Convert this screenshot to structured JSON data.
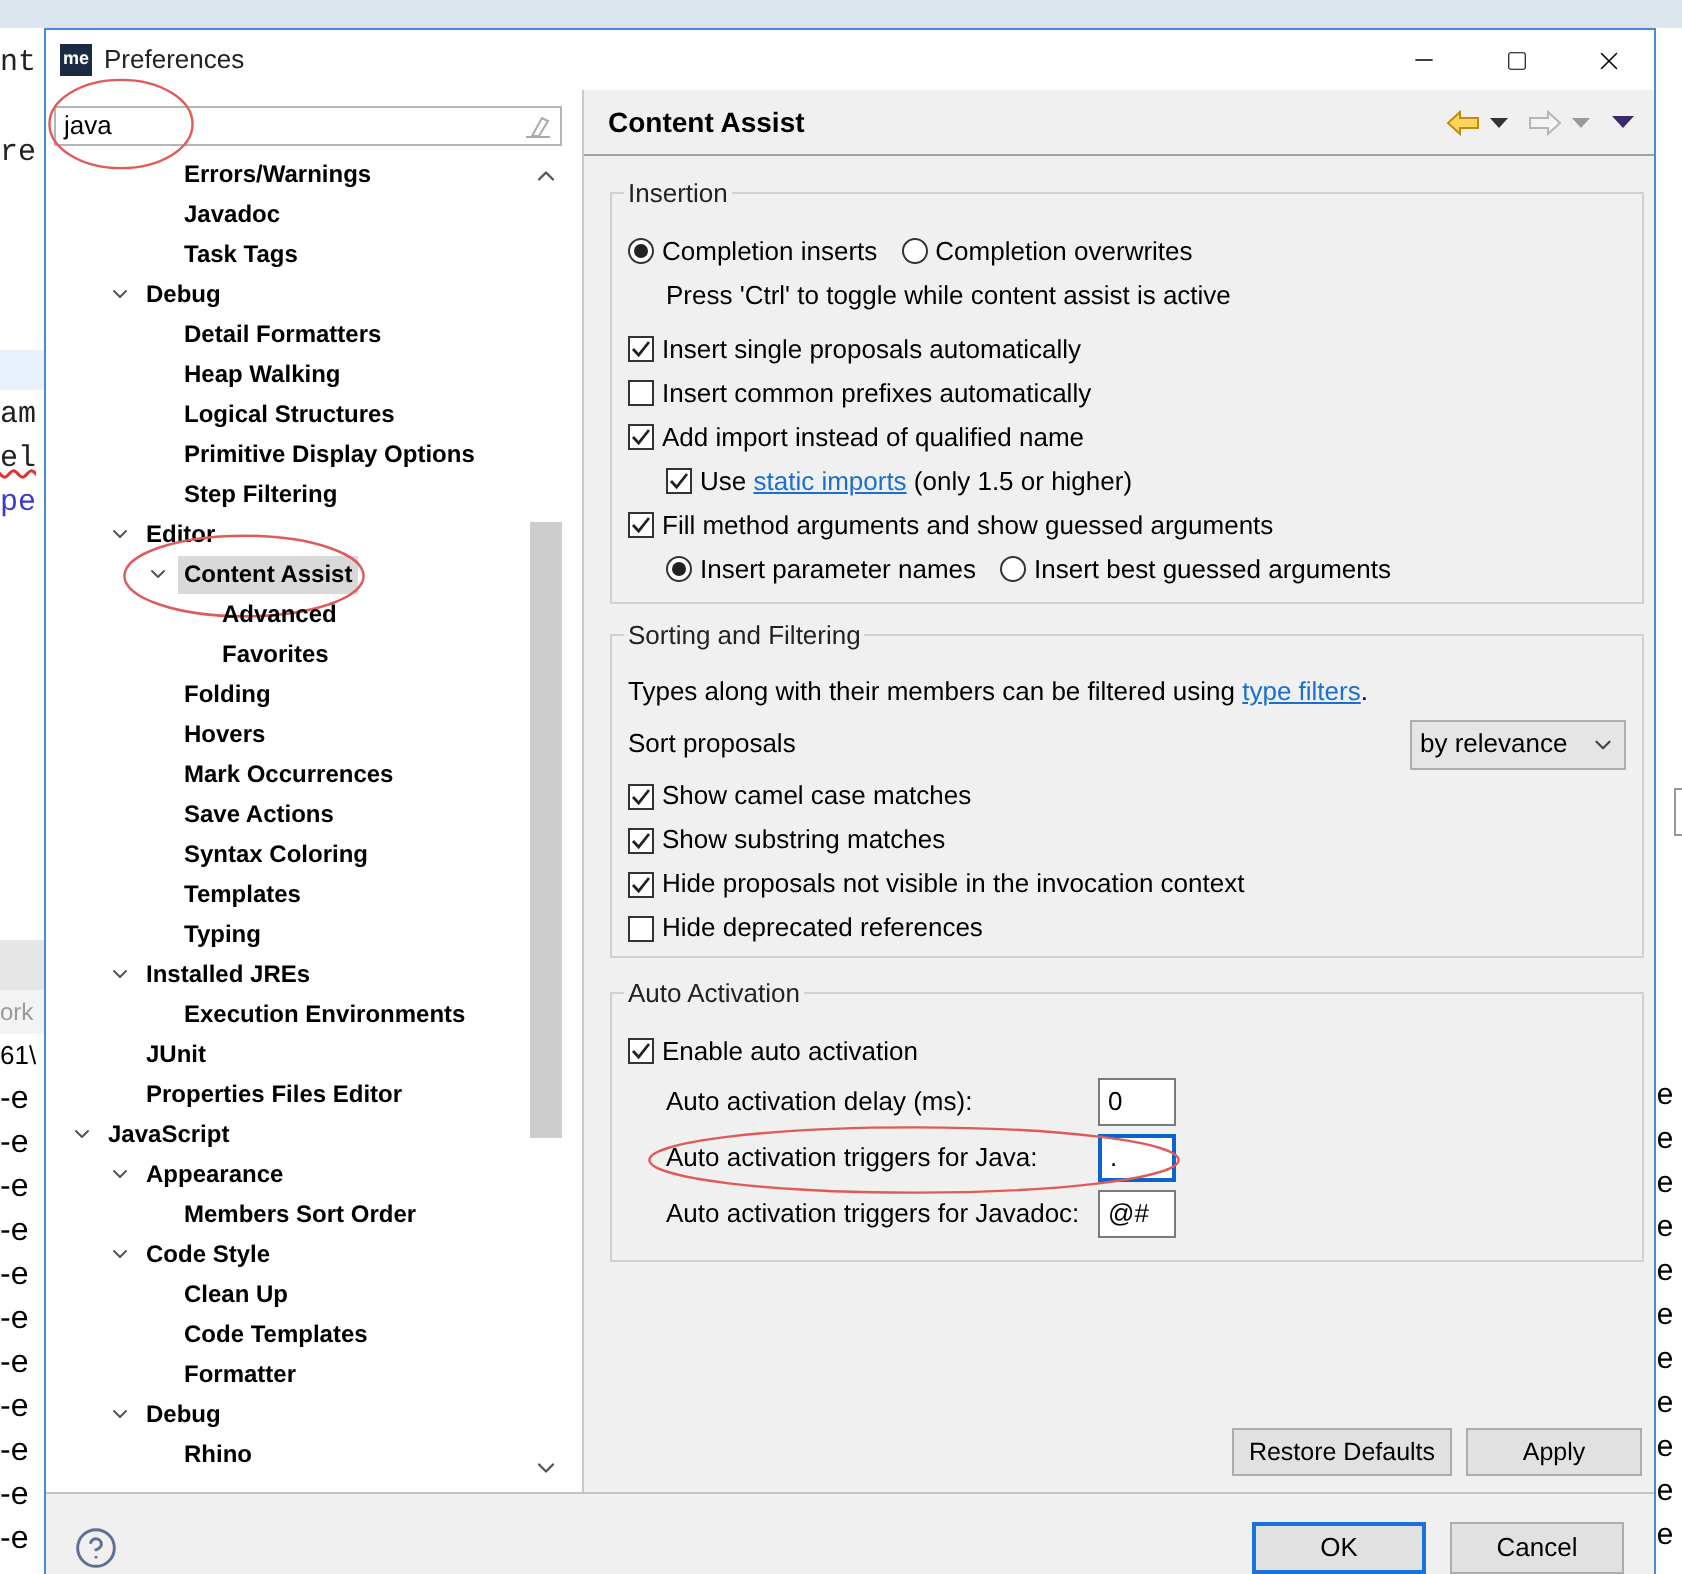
{
  "background": {
    "code_lines": [
      {
        "text": "nt",
        "kind": "plain"
      },
      {
        "text": "re",
        "kind": "plain"
      },
      {
        "text": "am",
        "kind": "plain"
      },
      {
        "text": "el",
        "kind": "error"
      },
      {
        "text": "pe",
        "kind": "keyword"
      }
    ],
    "console_tab": "ork",
    "console_path": "61\\",
    "console_lines": [
      "-e",
      "-e",
      "-e",
      "-e",
      "-e",
      "-e",
      "-e",
      "-e",
      "-e",
      "-e",
      "-e"
    ],
    "right_lines": [
      "e",
      "e",
      "e",
      "e",
      "e",
      "e",
      "e",
      "e",
      "e",
      "e",
      "e"
    ]
  },
  "window": {
    "icon_text": "me",
    "title": "Preferences"
  },
  "search": {
    "value": "java",
    "circled": true
  },
  "tree": [
    {
      "children": [
        {
          "children": [
            {
              "label": "Errors/Warnings",
              "selected": false,
              "circled": false
            },
            {
              "label": "Javadoc",
              "selected": false,
              "circled": false
            },
            {
              "label": "Task Tags",
              "selected": false,
              "circled": false
            }
          ]
        },
        {
          "label": "Debug",
          "expanded": true,
          "selected": false,
          "circled": false,
          "children": [
            {
              "label": "Detail Formatters",
              "selected": false,
              "circled": false
            },
            {
              "label": "Heap Walking",
              "selected": false,
              "circled": false
            },
            {
              "label": "Logical Structures",
              "selected": false,
              "circled": false
            },
            {
              "label": "Primitive Display Options",
              "selected": false,
              "circled": false
            },
            {
              "label": "Step Filtering",
              "selected": false,
              "circled": false
            }
          ]
        },
        {
          "label": "Editor",
          "expanded": true,
          "selected": false,
          "circled": false,
          "children": [
            {
              "label": "Content Assist",
              "expanded": true,
              "selected": true,
              "circled": true,
              "children": [
                {
                  "label": "Advanced",
                  "selected": false,
                  "circled": false
                },
                {
                  "label": "Favorites",
                  "selected": false,
                  "circled": false
                }
              ]
            },
            {
              "label": "Folding",
              "selected": false,
              "circled": false
            },
            {
              "label": "Hovers",
              "selected": false,
              "circled": false
            },
            {
              "label": "Mark Occurrences",
              "selected": false,
              "circled": false
            },
            {
              "label": "Save Actions",
              "selected": false,
              "circled": false
            },
            {
              "label": "Syntax Coloring",
              "selected": false,
              "circled": false
            },
            {
              "label": "Templates",
              "selected": false,
              "circled": false
            },
            {
              "label": "Typing",
              "selected": false,
              "circled": false
            }
          ]
        },
        {
          "label": "Installed JREs",
          "expanded": true,
          "selected": false,
          "circled": false,
          "children": [
            {
              "label": "Execution Environments",
              "selected": false,
              "circled": false
            }
          ]
        },
        {
          "label": "JUnit",
          "selected": false,
          "circled": false
        },
        {
          "label": "Properties Files Editor",
          "selected": false,
          "circled": false
        }
      ]
    },
    {
      "label": "JavaScript",
      "expanded": true,
      "selected": false,
      "circled": false,
      "children": [
        {
          "label": "Appearance",
          "expanded": true,
          "selected": false,
          "circled": false,
          "children": [
            {
              "label": "Members Sort Order",
              "selected": false,
              "circled": false
            }
          ]
        },
        {
          "label": "Code Style",
          "expanded": true,
          "selected": false,
          "circled": false,
          "children": [
            {
              "label": "Clean Up",
              "selected": false,
              "circled": false
            },
            {
              "label": "Code Templates",
              "selected": false,
              "circled": false
            },
            {
              "label": "Formatter",
              "selected": false,
              "circled": false
            }
          ]
        },
        {
          "label": "Debug",
          "expanded": true,
          "selected": false,
          "circled": false,
          "children": [
            {
              "label": "Rhino",
              "selected": false,
              "circled": false
            }
          ]
        }
      ]
    }
  ],
  "page": {
    "title": "Content Assist",
    "history": {
      "back_enabled": true,
      "forward_enabled": false
    }
  },
  "groups": [
    {
      "title": "Insertion",
      "rows": [
        {
          "kind": "radio_group",
          "indented": false,
          "options": [
            {
              "label": "Completion inserts",
              "selected": true
            },
            {
              "label": "Completion overwrites",
              "selected": false
            }
          ]
        },
        {
          "kind": "note",
          "indented": true,
          "text": "Press 'Ctrl' to toggle while content assist is active"
        },
        {
          "kind": "checkbox",
          "indented": false,
          "label": "Insert single proposals automatically",
          "checked": true
        },
        {
          "kind": "checkbox",
          "indented": false,
          "label": "Insert common prefixes automatically",
          "checked": false
        },
        {
          "kind": "checkbox",
          "indented": false,
          "label": "Add import instead of qualified name",
          "checked": true
        },
        {
          "kind": "checkbox",
          "indented": true,
          "label": "Use ",
          "link": "static imports",
          "after": " (only 1.5 or higher)",
          "checked": true
        },
        {
          "kind": "checkbox",
          "indented": false,
          "label": "Fill method arguments and show guessed arguments",
          "checked": true
        },
        {
          "kind": "radio_group",
          "indented": true,
          "options": [
            {
              "label": "Insert parameter names",
              "selected": true
            },
            {
              "label": "Insert best guessed arguments",
              "selected": false
            }
          ]
        }
      ]
    },
    {
      "title": "Sorting and Filtering",
      "rows": [
        {
          "kind": "text",
          "indented": false,
          "text": "Types along with their members can be filtered using ",
          "link": "type filters",
          "after": "."
        },
        {
          "kind": "select",
          "indented": false,
          "label": "Sort proposals",
          "value": "by relevance"
        },
        {
          "kind": "checkbox",
          "indented": false,
          "label": "Show camel case matches",
          "checked": true
        },
        {
          "kind": "checkbox",
          "indented": false,
          "label": "Show substring matches",
          "checked": true
        },
        {
          "kind": "checkbox",
          "indented": false,
          "label": "Hide proposals not visible in the invocation context",
          "checked": true
        },
        {
          "kind": "checkbox",
          "indented": false,
          "label": "Hide deprecated references",
          "checked": false
        }
      ]
    },
    {
      "title": "Auto Activation",
      "rows": [
        {
          "kind": "checkbox",
          "indented": false,
          "label": "Enable auto activation",
          "checked": true
        },
        {
          "kind": "field",
          "indented": true,
          "label": "Auto activation delay (ms):",
          "value": "0",
          "focused": false,
          "circled": false
        },
        {
          "kind": "field",
          "indented": true,
          "label": "Auto activation triggers for Java:",
          "value": ".",
          "focused": true,
          "circled": true
        },
        {
          "kind": "field",
          "indented": true,
          "label": "Auto activation triggers for Javadoc:",
          "value": "@#",
          "focused": false,
          "circled": false
        }
      ]
    }
  ],
  "page_buttons": [
    "Restore Defaults",
    "Apply"
  ],
  "footer_buttons": [
    {
      "label": "OK",
      "default": true
    },
    {
      "label": "Cancel",
      "default": false
    }
  ]
}
